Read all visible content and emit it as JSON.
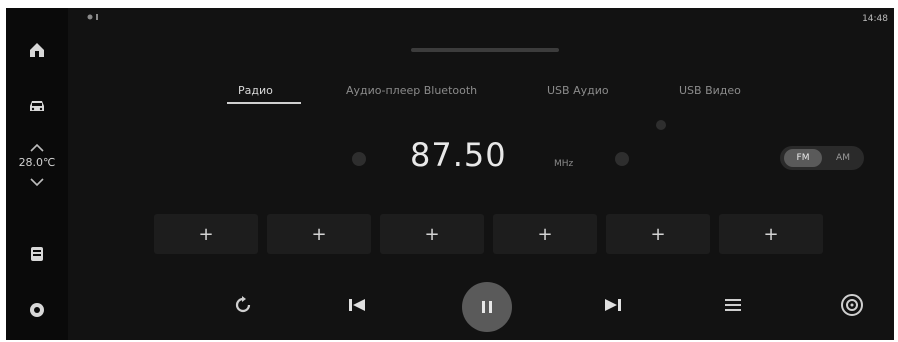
{
  "status": {
    "left_icons": [
      "signal-icon",
      "bluetooth-icon"
    ],
    "time": "14:48"
  },
  "sidebar": {
    "items": [
      {
        "icon": "home-icon"
      },
      {
        "icon": "car-icon"
      },
      {
        "icon": "apps-icon"
      },
      {
        "icon": "settings-icon"
      }
    ],
    "climate": {
      "temperature": "28.0℃"
    }
  },
  "tabs": [
    {
      "label": "Радио",
      "active": true
    },
    {
      "label": "Аудио-плеер Bluetooth",
      "active": false
    },
    {
      "label": "USB Аудио",
      "active": false
    },
    {
      "label": "USB Видео",
      "active": false
    }
  ],
  "radio": {
    "frequency": "87.50",
    "unit": "MHz",
    "band": {
      "fm": "FM",
      "am": "AM",
      "selected": "FM"
    }
  },
  "presets": [
    {
      "label": "+"
    },
    {
      "label": "+"
    },
    {
      "label": "+"
    },
    {
      "label": "+"
    },
    {
      "label": "+"
    },
    {
      "label": "+"
    }
  ],
  "controls": [
    "refresh-icon",
    "previous-icon",
    "pause-icon",
    "next-icon",
    "list-icon",
    "radio-scan-icon"
  ],
  "colors": {
    "background": "#121212",
    "sidebar": "#0a0a0a",
    "accent": "#5a5a5a",
    "text": "#e8e8e8"
  }
}
